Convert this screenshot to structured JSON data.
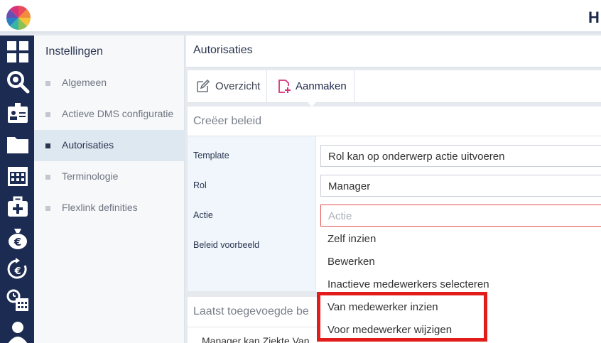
{
  "header": {
    "app_initial": "H"
  },
  "rail": {
    "icons": [
      "dashboard-icon",
      "search-icon",
      "id-card-icon",
      "folder-icon",
      "calendar-icon",
      "medical-kit-icon",
      "money-bag-icon",
      "euro-refresh-icon",
      "time-schedule-icon",
      "person-icon"
    ]
  },
  "submenu": {
    "title": "Instellingen",
    "items": [
      {
        "label": "Algemeen"
      },
      {
        "label": "Actieve DMS configuratie"
      },
      {
        "label": "Autorisaties",
        "active": true
      },
      {
        "label": "Terminologie"
      },
      {
        "label": "Flexlink definities"
      }
    ]
  },
  "page": {
    "title": "Autorisaties"
  },
  "tabs": {
    "overzicht": {
      "label": "Overzicht",
      "icon": "edit-icon"
    },
    "aanmaken": {
      "label": "Aanmaken",
      "icon": "add-document-icon"
    }
  },
  "form": {
    "title": "Creëer beleid",
    "template": {
      "label": "Template",
      "value": "Rol kan op onderwerp actie uitvoeren"
    },
    "rol": {
      "label": "Rol",
      "value": "Manager"
    },
    "actie": {
      "label": "Actie",
      "placeholder": "Actie"
    },
    "beleid": {
      "label": "Beleid voorbeeld"
    }
  },
  "dropdown": {
    "options": [
      {
        "label": "Zelf inzien"
      },
      {
        "label": "Bewerken"
      },
      {
        "label": "Inactieve medewerkers selecteren"
      },
      {
        "label": "Van medewerker inzien"
      },
      {
        "label": "Voor medewerker wijzigen"
      }
    ]
  },
  "recent": {
    "title": "Laatst toegevoegde be",
    "first_row": "Manager kan Ziekte Van"
  },
  "colors": {
    "rail": "#1c2b52",
    "accent_pink": "#d6317a",
    "highlight": "#e21b1b",
    "error_border": "#e0504c"
  }
}
